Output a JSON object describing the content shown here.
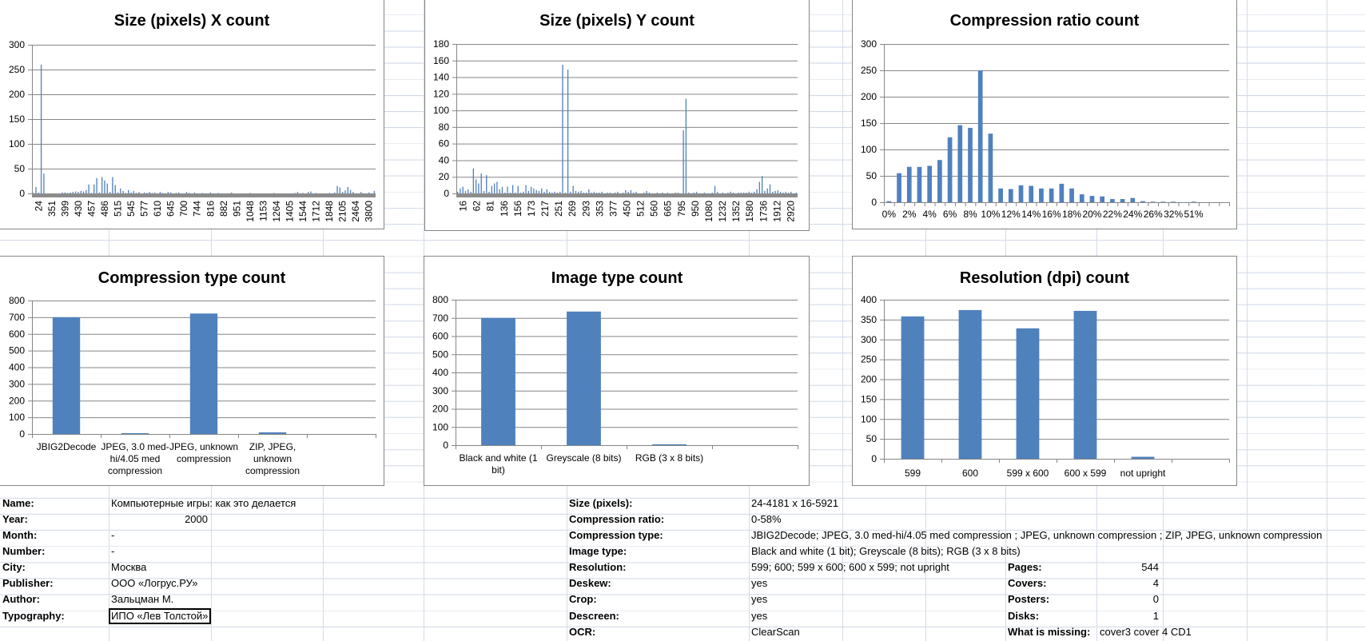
{
  "colors": {
    "bar": "#4f81bd",
    "grid": "#868686",
    "axis_band": "#8c8c8c"
  },
  "chart_data": [
    {
      "type": "bar",
      "title": "Size (pixels) X count",
      "ylim": [
        0,
        300
      ],
      "yticks": [
        0,
        50,
        100,
        150,
        200,
        250,
        300
      ],
      "tick_labels": [
        "24",
        "351",
        "399",
        "430",
        "457",
        "486",
        "515",
        "545",
        "577",
        "610",
        "645",
        "700",
        "744",
        "816",
        "882",
        "951",
        "1048",
        "1153",
        "1264",
        "1405",
        "1544",
        "1712",
        "1848",
        "2105",
        "2464",
        "3800"
      ],
      "values": [
        1,
        13,
        2,
        260,
        40,
        0,
        0,
        0,
        0,
        0,
        0,
        2,
        2,
        1,
        2,
        3,
        4,
        3,
        5,
        4,
        7,
        18,
        1,
        18,
        31,
        2,
        33,
        26,
        20,
        3,
        33,
        17,
        2,
        10,
        5,
        1,
        7,
        2,
        5,
        1,
        3,
        0,
        2,
        1,
        3,
        1,
        2,
        0,
        3,
        1,
        0,
        3,
        2,
        0,
        1,
        2,
        0,
        0,
        3,
        1,
        0,
        2,
        0,
        0,
        1,
        0,
        0,
        2,
        0,
        0,
        1,
        0,
        0,
        0,
        0,
        2,
        0,
        0,
        0,
        0,
        0,
        0,
        1,
        0,
        0,
        0,
        0,
        0,
        0,
        0,
        0,
        1,
        0,
        0,
        0,
        0,
        0,
        0,
        0,
        1,
        3,
        0,
        1,
        0,
        3,
        4,
        0,
        1,
        0,
        0,
        0,
        0,
        1,
        0,
        2,
        15,
        12,
        3,
        6,
        13,
        7,
        3,
        0,
        0,
        3,
        0,
        0,
        2,
        0,
        5
      ]
    },
    {
      "type": "bar",
      "title": "Size (pixels) Y count",
      "ylim": [
        0,
        180
      ],
      "yticks": [
        0,
        20,
        40,
        60,
        80,
        100,
        120,
        140,
        160,
        180
      ],
      "tick_labels": [
        "16",
        "62",
        "81",
        "136",
        "156",
        "173",
        "217",
        "251",
        "269",
        "293",
        "353",
        "377",
        "450",
        "512",
        "560",
        "665",
        "795",
        "950",
        "1080",
        "1232",
        "1352",
        "1580",
        "1736",
        "1912",
        "2920"
      ],
      "values": [
        2,
        6,
        8,
        3,
        5,
        2,
        30,
        17,
        12,
        24,
        3,
        22,
        2,
        9,
        12,
        14,
        5,
        8,
        1,
        8,
        1,
        10,
        1,
        9,
        1,
        2,
        10,
        3,
        8,
        6,
        4,
        3,
        6,
        2,
        5,
        2,
        1,
        2,
        1,
        2,
        155,
        1,
        149,
        2,
        9,
        3,
        2,
        3,
        1,
        1,
        5,
        1,
        2,
        1,
        1,
        2,
        0,
        1,
        1,
        0,
        1,
        2,
        0,
        1,
        4,
        2,
        4,
        1,
        2,
        0,
        0,
        1,
        3,
        1,
        0,
        0,
        1,
        0,
        1,
        0,
        1,
        0,
        0,
        1,
        1,
        0,
        76,
        114,
        1,
        0,
        1,
        2,
        0,
        0,
        1,
        0,
        0,
        1,
        9,
        2,
        0,
        1,
        0,
        1,
        2,
        1,
        0,
        1,
        1,
        1,
        1,
        2,
        1,
        2,
        5,
        14,
        21,
        3,
        6,
        11,
        2,
        3,
        4,
        2,
        1,
        2,
        1,
        2,
        0,
        1
      ]
    },
    {
      "type": "bar",
      "title": "Compression ratio count",
      "ylim": [
        0,
        300
      ],
      "yticks": [
        0,
        50,
        100,
        150,
        200,
        250,
        300
      ],
      "categories": [
        "0%",
        "1%",
        "2%",
        "3%",
        "4%",
        "5%",
        "6%",
        "7%",
        "8%",
        "9%",
        "10%",
        "11%",
        "12%",
        "13%",
        "14%",
        "15%",
        "16%",
        "17%",
        "18%",
        "19%",
        "20%",
        "21%",
        "22%",
        "23%",
        "24%",
        "25%",
        "26%",
        "29%",
        "32%",
        "40%",
        "51%"
      ],
      "values": [
        2,
        55,
        67,
        67,
        69,
        80,
        123,
        146,
        141,
        250,
        130,
        26,
        25,
        32,
        31,
        26,
        26,
        35,
        26,
        15,
        12,
        11,
        6,
        6,
        8,
        2,
        1,
        1,
        1,
        0,
        1
      ]
    },
    {
      "type": "bar",
      "title": "Compression type count",
      "ylim": [
        0,
        800
      ],
      "yticks": [
        0,
        100,
        200,
        300,
        400,
        500,
        600,
        700,
        800
      ],
      "categories": [
        "JBIG2Decode",
        "JPEG, 3.0 med-\nhi/4.05 med\ncompression",
        "JPEG, unknown\ncompression",
        "ZIP, JPEG,\nunknown\ncompression"
      ],
      "values": [
        700,
        5,
        722,
        10
      ]
    },
    {
      "type": "bar",
      "title": "Image type count",
      "ylim": [
        0,
        800
      ],
      "yticks": [
        0,
        100,
        200,
        300,
        400,
        500,
        600,
        700,
        800
      ],
      "categories": [
        "Black and white (1\nbit)",
        "Greyscale (8 bits)",
        "RGB (3 x 8 bits)"
      ],
      "values": [
        700,
        735,
        5
      ]
    },
    {
      "type": "bar",
      "title": "Resolution (dpi) count",
      "ylim": [
        0,
        400
      ],
      "yticks": [
        0,
        50,
        100,
        150,
        200,
        250,
        300,
        350,
        400
      ],
      "categories": [
        "599",
        "600",
        "599 x 600",
        "600 x 599",
        "not upright"
      ],
      "values": [
        358,
        374,
        328,
        372,
        5
      ]
    }
  ],
  "info_left": [
    {
      "label": "Name:",
      "value": "Компьютерные игры: как это делается"
    },
    {
      "label": "Year:",
      "value": "2000"
    },
    {
      "label": "Month:",
      "value": "-"
    },
    {
      "label": "Number:",
      "value": "-"
    },
    {
      "label": "City:",
      "value": "Москва"
    },
    {
      "label": "Publisher:",
      "value": "ООО «Логрус.РУ»"
    },
    {
      "label": "Author:",
      "value": "Зальцман М."
    },
    {
      "label": "Typography:",
      "value": "ИПО «Лев Толстой»"
    }
  ],
  "info_mid": [
    {
      "label": "Size (pixels):",
      "value": "24-4181 x 16-5921"
    },
    {
      "label": "Compression ratio:",
      "value": "0-58%"
    },
    {
      "label": "Compression type:",
      "value": "JBIG2Decode; JPEG, 3.0 med-hi/4.05 med compression ; JPEG, unknown compression ; ZIP, JPEG, unknown compression"
    },
    {
      "label": "Image type:",
      "value": "Black and white (1 bit); Greyscale (8 bits); RGB (3 x 8 bits)"
    },
    {
      "label": "Resolution:",
      "value": "599; 600; 599 x 600; 600 x 599; not upright"
    },
    {
      "label": "Deskew:",
      "value": "yes"
    },
    {
      "label": "Crop:",
      "value": "yes"
    },
    {
      "label": "Descreen:",
      "value": "yes"
    },
    {
      "label": "OCR:",
      "value": "ClearScan"
    }
  ],
  "info_right": [
    {
      "label": "Pages:",
      "value": "544"
    },
    {
      "label": "Covers:",
      "value": "4"
    },
    {
      "label": "Posters:",
      "value": "0"
    },
    {
      "label": "Disks:",
      "value": "1"
    },
    {
      "label": "What is missing:",
      "value": "cover3 cover 4 CD1"
    }
  ]
}
